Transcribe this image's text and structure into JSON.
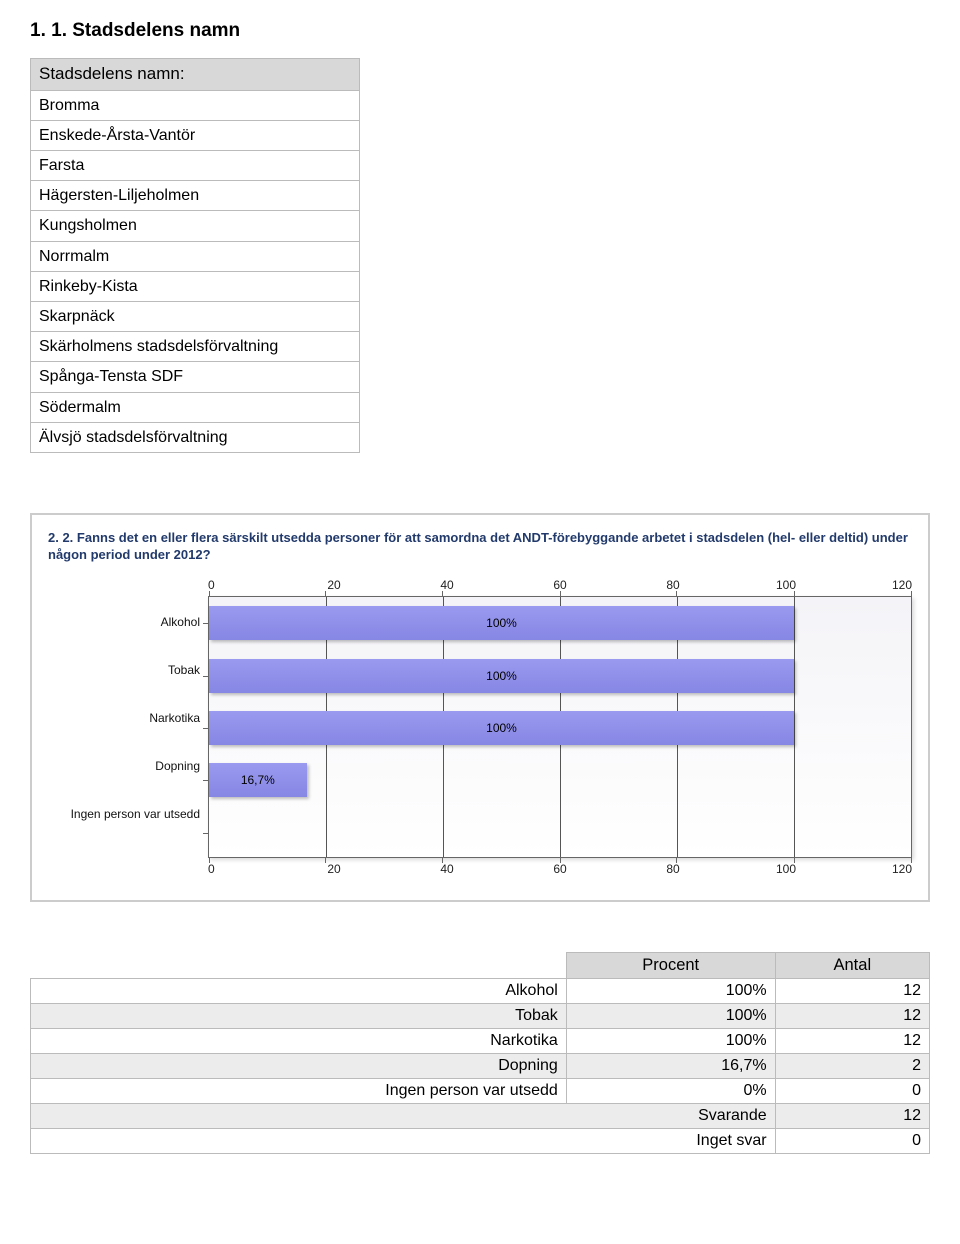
{
  "section1": {
    "heading": "1. 1. Stadsdelens namn",
    "list_header": "Stadsdelens namn:",
    "items": [
      "Bromma",
      "Enskede-Årsta-Vantör",
      "Farsta",
      "Hägersten-Liljeholmen",
      "Kungsholmen",
      "Norrmalm",
      "Rinkeby-Kista",
      "Skarpnäck",
      "Skärholmens stadsdelsförvaltning",
      "Spånga-Tensta SDF",
      "Södermalm",
      "Älvsjö stadsdelsförvaltning"
    ]
  },
  "chart_data": {
    "type": "bar",
    "orientation": "horizontal",
    "title": "2. 2. Fanns det en eller flera särskilt utsedda personer för att samordna det ANDT-förebyggande arbetet i stadsdelen (hel- eller deltid) under någon period under 2012?",
    "categories": [
      "Alkohol",
      "Tobak",
      "Narkotika",
      "Dopning",
      "Ingen person var utsedd"
    ],
    "values": [
      100,
      100,
      100,
      16.7,
      0
    ],
    "bar_labels": [
      "100%",
      "100%",
      "100%",
      "16,7%",
      ""
    ],
    "xlabel": "",
    "ylabel": "",
    "xlim": [
      0,
      120
    ],
    "ticks": [
      "0",
      "20",
      "40",
      "60",
      "80",
      "100",
      "120"
    ]
  },
  "result": {
    "col_headers": [
      "Procent",
      "Antal"
    ],
    "rows": [
      {
        "label": "Alkohol",
        "percent": "100%",
        "count": "12"
      },
      {
        "label": "Tobak",
        "percent": "100%",
        "count": "12"
      },
      {
        "label": "Narkotika",
        "percent": "100%",
        "count": "12"
      },
      {
        "label": "Dopning",
        "percent": "16,7%",
        "count": "2"
      },
      {
        "label": "Ingen person var utsedd",
        "percent": "0%",
        "count": "0"
      }
    ],
    "footer": [
      {
        "label": "Svarande",
        "value": "12"
      },
      {
        "label": "Inget svar",
        "value": "0"
      }
    ]
  }
}
